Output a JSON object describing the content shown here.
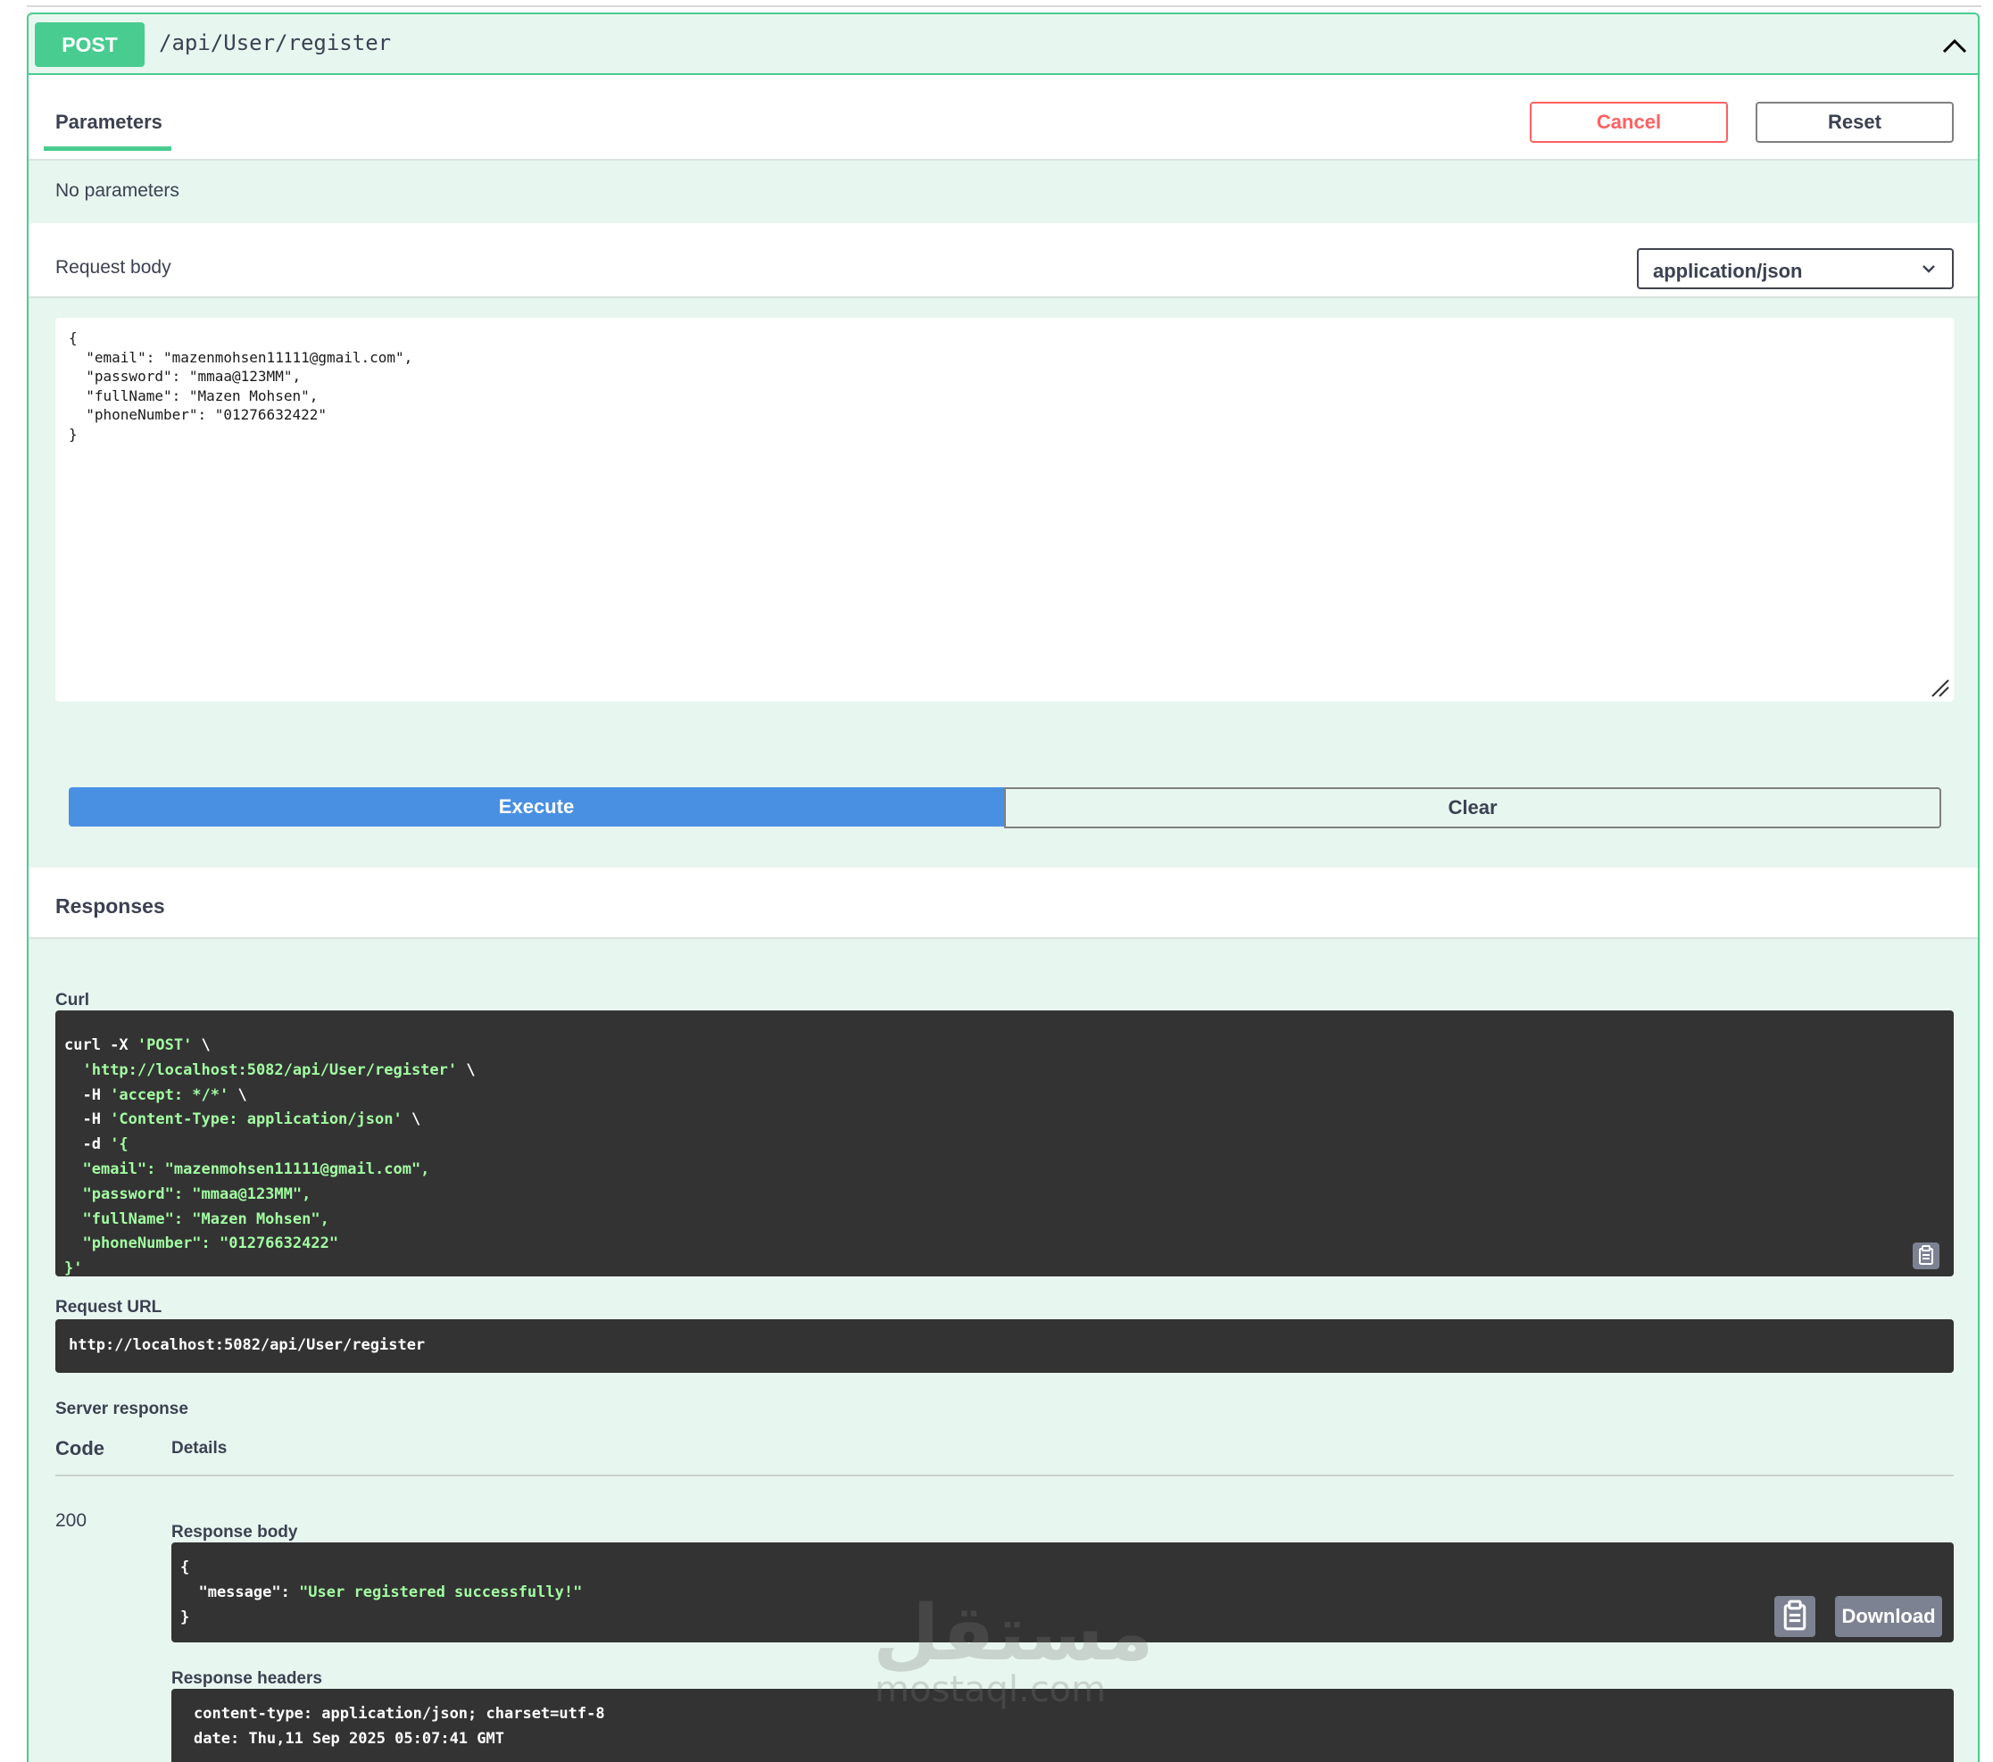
{
  "endpoint": {
    "method": "POST",
    "path": "/api/User/register"
  },
  "tabs": {
    "parameters_label": "Parameters",
    "cancel_label": "Cancel",
    "reset_label": "Reset"
  },
  "parameters": {
    "empty_text": "No parameters"
  },
  "request_body": {
    "label": "Request body",
    "content_type": "application/json",
    "json_lines": [
      "{",
      "  \"email\": \"mazenmohsen11111@gmail.com\",",
      "  \"password\": \"mmaa@123MM\",",
      "  \"fullName\": \"Mazen Mohsen\",",
      "  \"phoneNumber\": \"01276632422\"",
      "}"
    ]
  },
  "actions": {
    "execute_label": "Execute",
    "clear_label": "Clear"
  },
  "responses": {
    "title": "Responses",
    "curl_label": "Curl",
    "curl_lines": [
      [
        "curl -X ",
        "'POST'",
        " \\"
      ],
      [
        "  ",
        "'http://localhost:5082/api/User/register'",
        " \\"
      ],
      [
        "  -H ",
        "'accept: */*'",
        " \\"
      ],
      [
        "  -H ",
        "'Content-Type: application/json'",
        " \\"
      ],
      [
        "  -d ",
        "'{",
        ""
      ],
      [
        "  ",
        "\"email\": \"mazenmohsen11111@gmail.com\",",
        ""
      ],
      [
        "  ",
        "\"password\": \"mmaa@123MM\",",
        ""
      ],
      [
        "  ",
        "\"fullName\": \"Mazen Mohsen\",",
        ""
      ],
      [
        "  ",
        "\"phoneNumber\": \"01276632422\"",
        ""
      ],
      [
        "",
        "}'",
        ""
      ]
    ],
    "request_url_label": "Request URL",
    "request_url": "http://localhost:5082/api/User/register",
    "server_response_label": "Server response",
    "code_header": "Code",
    "details_header": "Details",
    "status_code": "200",
    "response_body_label": "Response body",
    "response_body": {
      "open": "{",
      "key": "  \"message\": ",
      "value": "\"User registered successfully!\"",
      "close": "}"
    },
    "download_label": "Download",
    "response_headers_label": "Response headers",
    "response_headers": [
      "content-type: application/json; charset=utf-8",
      "date: Thu,11 Sep 2025 05:07:41 GMT"
    ]
  },
  "watermark": {
    "arabic": "مستقل",
    "latin": "mostaql.com"
  },
  "colors": {
    "post_green": "#49cc90",
    "execute_blue": "#4990e2",
    "cancel_red": "#ff6060",
    "code_bg": "#333333",
    "code_string": "#a2fca2"
  }
}
